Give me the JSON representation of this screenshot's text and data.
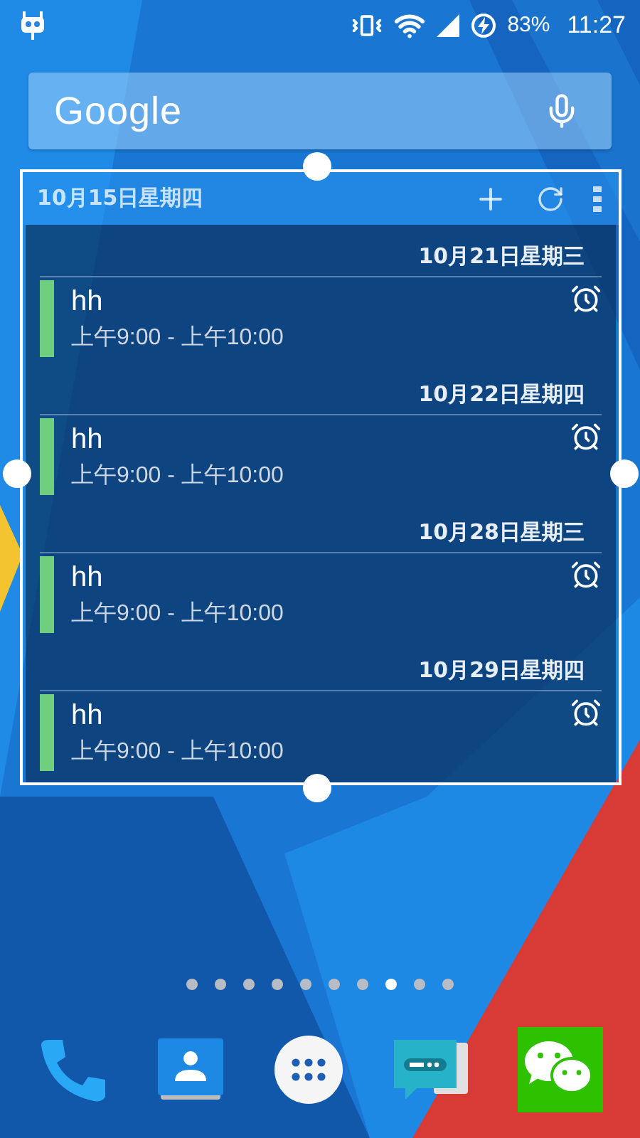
{
  "status_bar": {
    "battery": "83%",
    "time": "11:27"
  },
  "search_bar": {
    "logo": "Google"
  },
  "calendar_widget": {
    "header_date": "10月15日星期四",
    "days": [
      {
        "date": "10月21日星期三",
        "events": [
          {
            "title": "hh",
            "time": "上午9:00 - 上午10:00"
          }
        ]
      },
      {
        "date": "10月22日星期四",
        "events": [
          {
            "title": "hh",
            "time": "上午9:00 - 上午10:00"
          }
        ]
      },
      {
        "date": "10月28日星期三",
        "events": [
          {
            "title": "hh",
            "time": "上午9:00 - 上午10:00"
          }
        ]
      },
      {
        "date": "10月29日星期四",
        "events": [
          {
            "title": "hh",
            "time": "上午9:00 - 上午10:00"
          }
        ]
      }
    ]
  },
  "page_indicator": [
    {
      "selected": false
    },
    {
      "selected": false
    },
    {
      "selected": false
    },
    {
      "selected": false
    },
    {
      "selected": false
    },
    {
      "selected": false
    },
    {
      "selected": false
    },
    {
      "selected": true
    },
    {
      "selected": false
    },
    {
      "selected": false
    }
  ],
  "dock": [
    {
      "kind": "phone"
    },
    {
      "kind": "contacts"
    },
    {
      "kind": "apps"
    },
    {
      "kind": "messages"
    },
    {
      "kind": "chat"
    }
  ]
}
